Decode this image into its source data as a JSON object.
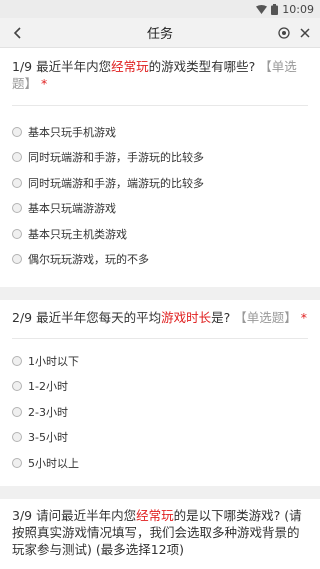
{
  "status_bar": {
    "time": "10:09"
  },
  "nav": {
    "title": "任务"
  },
  "questions": [
    {
      "number": "1/9",
      "text_before": "最近半年内您",
      "highlight": "经常玩",
      "text_after": "的游戏类型有哪些?",
      "tag": "【单选题】",
      "required_mark": "*",
      "options": [
        "基本只玩手机游戏",
        "同时玩端游和手游，手游玩的比较多",
        "同时玩端游和手游，端游玩的比较多",
        "基本只玩端游游戏",
        "基本只玩主机类游戏",
        "偶尔玩玩游戏，玩的不多"
      ]
    },
    {
      "number": "2/9",
      "text_before": "最近半年您每天的平均",
      "highlight": "游戏时长",
      "text_after": "是?",
      "tag": "【单选题】",
      "required_mark": "*",
      "options": [
        "1小时以下",
        "1-2小时",
        "2-3小时",
        "3-5小时",
        "5小时以上"
      ]
    },
    {
      "number": "3/9",
      "text_before": "请问最近半年内您",
      "highlight": "经常玩",
      "text_after": "的是以下哪类游戏? (请按照真实游戏情况填写，我们会选取多种游戏背景的玩家参与测试) (最多选择12项)"
    }
  ],
  "colors": {
    "highlight": "#e02020",
    "tag": "#999999",
    "nav_background": "#f2f2f2",
    "section_gap": "#f0f0f0"
  }
}
